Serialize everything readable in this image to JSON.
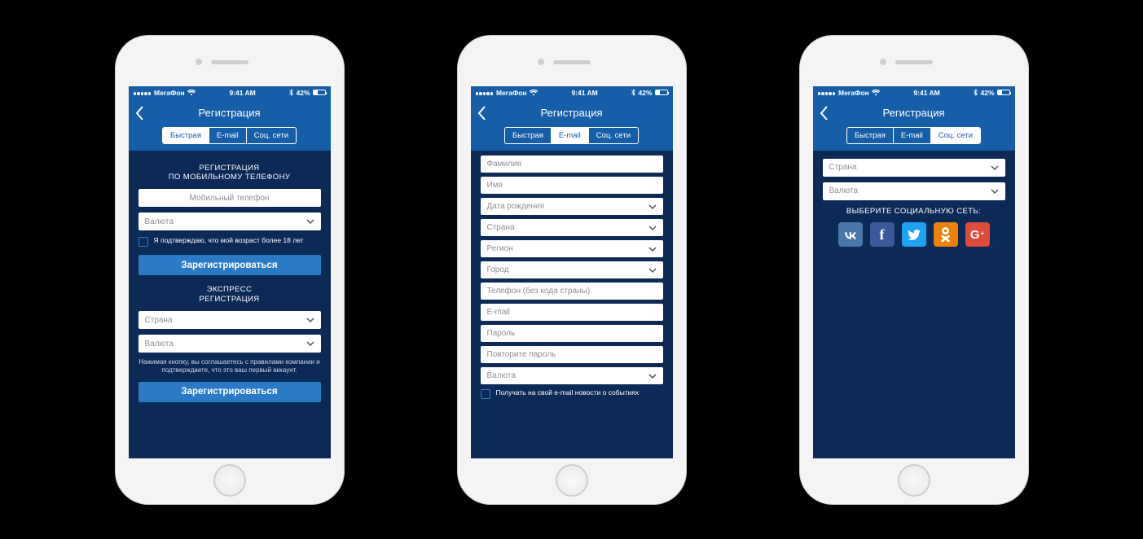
{
  "status": {
    "carrier": "МегаФон",
    "time": "9:41 AM",
    "battery_pct": "42%"
  },
  "header": {
    "title": "Регистрация"
  },
  "tabs": {
    "quick": "Быстрая",
    "email": "E-mail",
    "social": "Соц. сети"
  },
  "screen1": {
    "section1_title_line1": "РЕГИСТРАЦИЯ",
    "section1_title_line2": "ПО МОБИЛЬНОМУ ТЕЛЕФОНУ",
    "phone_placeholder": "Мобильный телефон",
    "currency_placeholder": "Валюта",
    "age_confirm": "Я подтверждаю, что мой возраст более 18 лет",
    "register_btn": "Зарегистрироваться",
    "section2_title_line1": "ЭКСПРЕСС",
    "section2_title_line2": "РЕГИСТРАЦИЯ",
    "country_placeholder": "Страна",
    "terms_text": "Нажимая кнопку, вы соглашаетесь с правилами компании и подтверждаете, что это ваш первый аккаунт."
  },
  "screen2": {
    "lastname": "Фамилия",
    "firstname": "Имя",
    "dob": "Дата рождения",
    "country": "Страна",
    "region": "Регион",
    "city": "Город",
    "phone": "Телефон (без кода страны)",
    "email": "E-mail",
    "password": "Пароль",
    "password2": "Повторите пароль",
    "currency": "Валюта",
    "news_opt": "Получать на свой e-mail новости о событиях"
  },
  "screen3": {
    "country": "Страна",
    "currency": "Валюта",
    "choose_social": "ВЫБЕРИТЕ СОЦИАЛЬНУЮ СЕТЬ:",
    "networks": {
      "vk": "VK",
      "fb": "f",
      "tw": "Twitter",
      "ok": "OK",
      "gp": "G"
    }
  }
}
